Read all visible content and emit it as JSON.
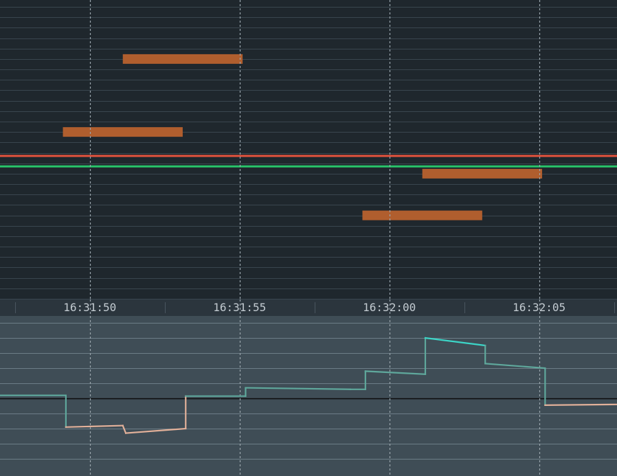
{
  "colors": {
    "top_background": "#1f272d",
    "top_gridline": "#3a464f",
    "bottom_background": "#3f4d56",
    "bottom_gridline": "#6d7e88",
    "axis_background": "#2b353d",
    "time_marker": "#9aa5ad",
    "order_bar": "#b05e2e",
    "ask_line": "#e5533d",
    "bid_line": "#29c56a",
    "step_up": "#5fa89c",
    "step_down": "#e3b19a",
    "step_peak": "#3cd6c8",
    "baseline": "#0c0c0c"
  },
  "time_axis": {
    "labels": [
      "16:31:50",
      "16:31:55",
      "16:32:00",
      "16:32:05"
    ]
  },
  "chart_data": {
    "type": "line",
    "x_unit": "seconds",
    "x_range": [
      "16:31:47",
      "16:32:07.6"
    ],
    "time_markers": [
      "16:31:50",
      "16:31:55",
      "16:32:00",
      "16:32:05"
    ],
    "top_panel": {
      "grid": true,
      "level_count": 29,
      "level_range": [
        0,
        28
      ],
      "horizontal_lines": [
        {
          "name": "ask",
          "level": 14.3,
          "color": "#e5533d"
        },
        {
          "name": "bid",
          "level": 15.3,
          "color": "#29c56a"
        }
      ],
      "bars": [
        {
          "start": "16:31:51.1",
          "end": "16:31:55.1",
          "level": 5
        },
        {
          "start": "16:31:49.1",
          "end": "16:31:53.1",
          "level": 12
        },
        {
          "start": "16:32:01.1",
          "end": "16:32:05.1",
          "level": 16
        },
        {
          "start": "16:31:59.1",
          "end": "16:32:03.1",
          "level": 20
        }
      ]
    },
    "bottom_panel": {
      "grid": true,
      "baseline": 0,
      "ylim": [
        -4,
        5
      ],
      "step_points": [
        [
          "16:31:47",
          0.2
        ],
        [
          "16:31:49.2",
          0.2
        ],
        [
          "16:31:49.2",
          -1.9
        ],
        [
          "16:31:51.1",
          -1.8
        ],
        [
          "16:31:51.2",
          -2.3
        ],
        [
          "16:31:53.2",
          -2.0
        ],
        [
          "16:31:53.2",
          0.15
        ],
        [
          "16:31:55.2",
          0.15
        ],
        [
          "16:31:55.2",
          0.7
        ],
        [
          "16:31:58.7",
          0.6
        ],
        [
          "16:31:59.2",
          0.6
        ],
        [
          "16:31:59.2",
          1.8
        ],
        [
          "16:32:01.2",
          1.6
        ],
        [
          "16:32:01.2",
          4.0
        ],
        [
          "16:32:03.2",
          3.5
        ],
        [
          "16:32:03.2",
          2.3
        ],
        [
          "16:32:05.2",
          2.0
        ],
        [
          "16:32:05.2",
          -0.45
        ],
        [
          "16:32:07.6",
          -0.4
        ]
      ]
    }
  }
}
